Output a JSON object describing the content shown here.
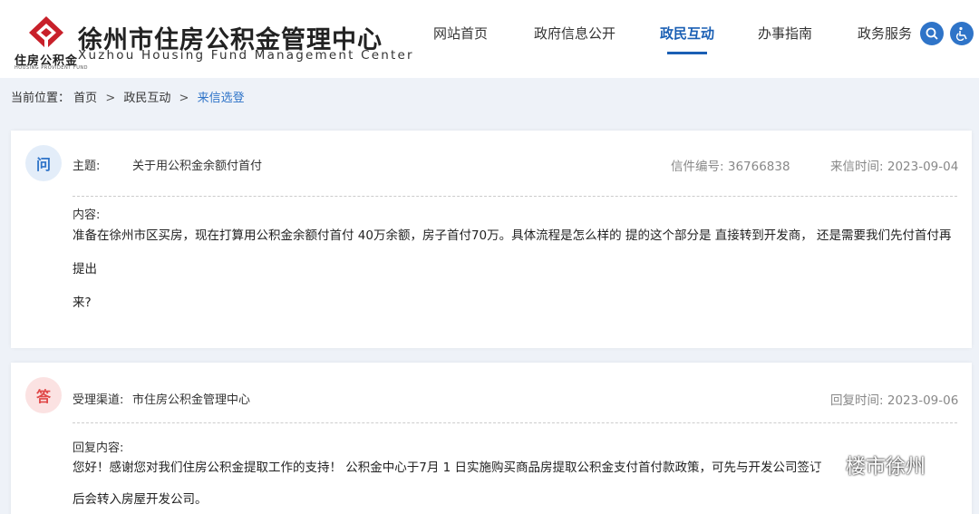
{
  "header": {
    "org_name_cn": "徐州市住房公积金管理中心",
    "org_name_en": "Xuzhou Housing Fund Management Center",
    "logo_small_cn": "住房公积金",
    "logo_small_en": "HOUSING PROVIDENT FUND",
    "nav": [
      {
        "label": "网站首页",
        "active": false
      },
      {
        "label": "政府信息公开",
        "active": false
      },
      {
        "label": "政民互动",
        "active": true
      },
      {
        "label": "办事指南",
        "active": false
      },
      {
        "label": "政务服务",
        "active": false
      }
    ],
    "icons": [
      "search-icon",
      "accessibility-icon"
    ],
    "accent_color": "#1a5fb4"
  },
  "breadcrumb": {
    "prefix": "当前位置：",
    "items": [
      "首页",
      "政民互动",
      "来信选登"
    ],
    "separator": ">"
  },
  "question": {
    "badge": "问",
    "subject_label": "主题:",
    "subject": "关于用公积金余额付首付",
    "letter_no_label": "信件编号:",
    "letter_no": "36766838",
    "date_label": "来信时间:",
    "date": "2023-09-04",
    "content_label": "内容:",
    "content_line1": "准备在徐州市区买房，现在打算用公积金余额付首付 40万余额，房子首付70万。具体流程是怎么样的 提的这个部分是 直接转到开发商， 还是需要我们先付首付再提出",
    "content_line2": "来?"
  },
  "answer": {
    "badge": "答",
    "channel_label": "受理渠道:",
    "channel": "市住房公积金管理中心",
    "date_label": "回复时间:",
    "date": "2023-09-06",
    "content_label": "回复内容:",
    "content_line1": "您好！感谢您对我们住房公积金提取工作的支持！ 公积金中心于7月 1 日实施购买商品房提取公积金支付首付款政策，可先与开发公司签订",
    "content_line2": "后会转入房屋开发公司。"
  },
  "watermark": {
    "text": "楼市徐州"
  }
}
